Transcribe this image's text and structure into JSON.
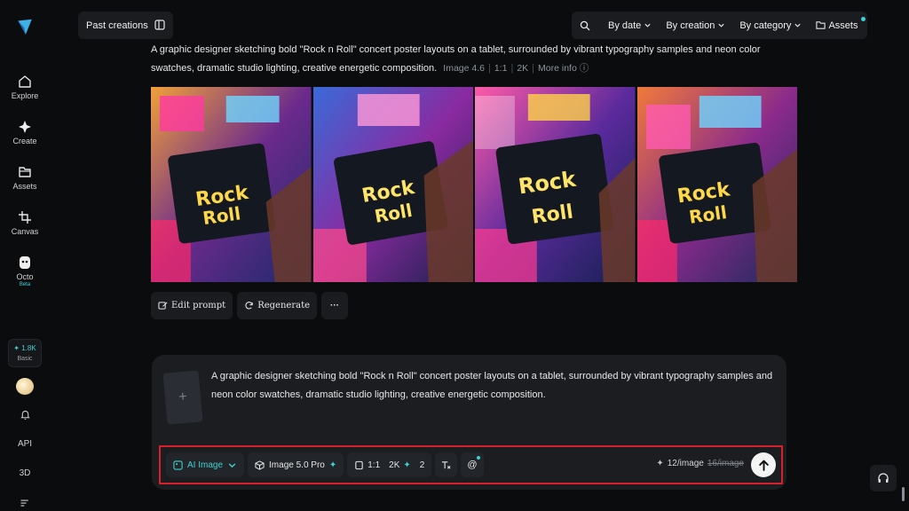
{
  "sidebar": {
    "items": [
      {
        "label": "Explore",
        "icon": "home-icon"
      },
      {
        "label": "Create",
        "icon": "sparkle-icon"
      },
      {
        "label": "Assets",
        "icon": "folder-icon"
      },
      {
        "label": "Canvas",
        "icon": "crop-icon"
      },
      {
        "label": "Octo",
        "icon": "octo-icon",
        "badge": "Beta"
      }
    ],
    "credits": {
      "value": "1.8K",
      "plan": "Basic"
    },
    "api_label": "API",
    "threed_label": "3D"
  },
  "topbar": {
    "past_creations": "Past creations",
    "filters": [
      "By date",
      "By creation",
      "By category"
    ],
    "assets": "Assets"
  },
  "generation": {
    "prompt": "A graphic designer sketching bold \"Rock n Roll\" concert poster layouts on a tablet, surrounded by vibrant typography samples and neon color swatches, dramatic studio lighting, creative energetic composition.",
    "model": "Image 4.6",
    "ratio": "1:1",
    "resolution": "2K",
    "more_info": "More info",
    "actions": {
      "edit": "Edit prompt",
      "regenerate": "Regenerate"
    }
  },
  "composer": {
    "text": "A graphic designer sketching bold \"Rock n Roll\" concert poster layouts on a tablet, surrounded by vibrant typography samples and neon color swatches, dramatic studio lighting, creative energetic composition.",
    "mode": "AI Image",
    "model": "Image 5.0 Pro",
    "ratio": "1:1",
    "resolution": "2K",
    "count": "2",
    "cost": "12/image",
    "old_cost": "16/image"
  },
  "colors": {
    "accent": "#3fd1d1",
    "highlight_border": "#d8202a",
    "background": "#0b0c0e"
  }
}
